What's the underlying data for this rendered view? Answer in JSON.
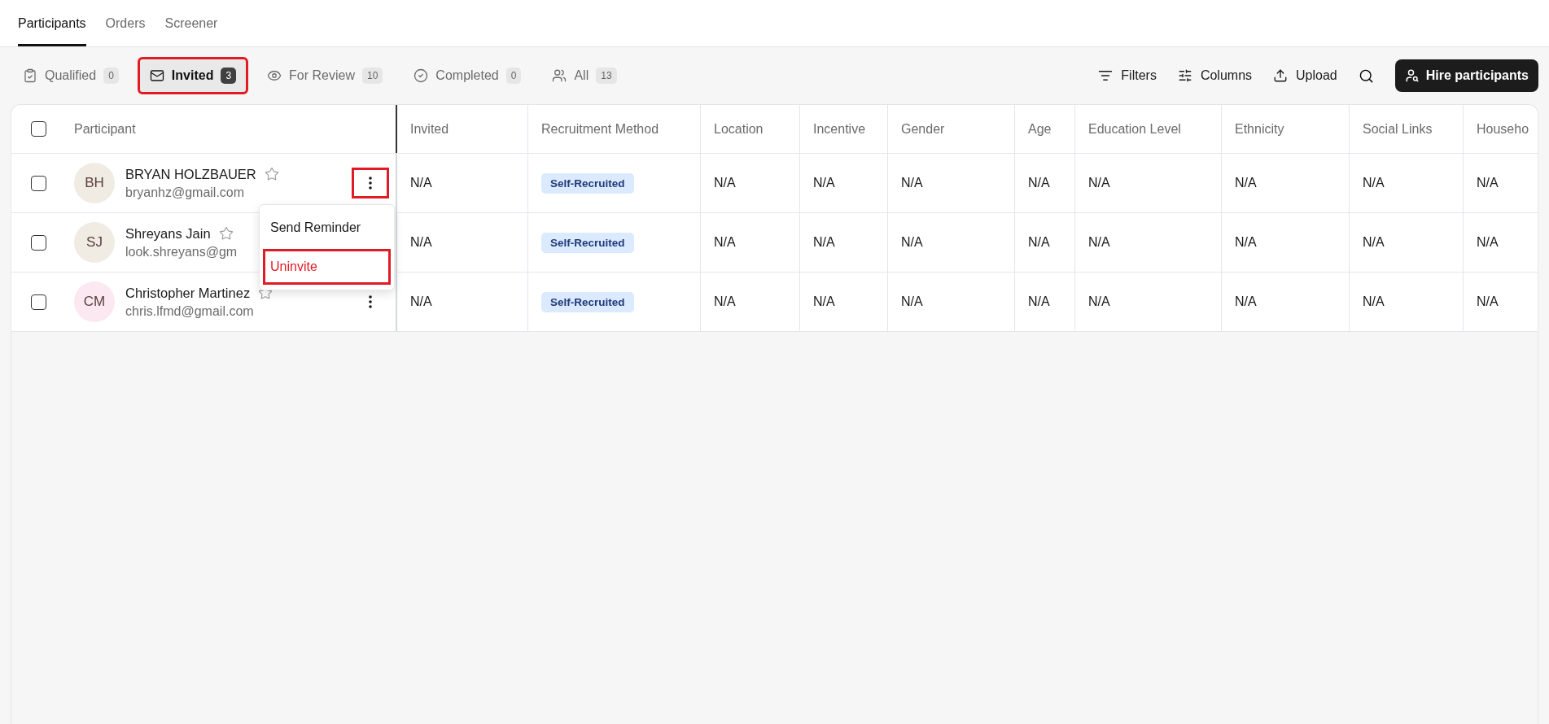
{
  "nav_tabs": [
    {
      "label": "Participants",
      "selected": true
    },
    {
      "label": "Orders",
      "selected": false
    },
    {
      "label": "Screener",
      "selected": false
    }
  ],
  "status_tabs": [
    {
      "label": "Qualified",
      "count": "0",
      "selected": false,
      "highlighted": false
    },
    {
      "label": "Invited",
      "count": "3",
      "selected": true,
      "highlighted": true
    },
    {
      "label": "For Review",
      "count": "10",
      "selected": false,
      "highlighted": false
    },
    {
      "label": "Completed",
      "count": "0",
      "selected": false,
      "highlighted": false
    },
    {
      "label": "All",
      "count": "13",
      "selected": false,
      "highlighted": false
    }
  ],
  "toolbar": {
    "actions": [
      "Filters",
      "Columns",
      "Upload"
    ],
    "primary_button": "Hire participants"
  },
  "table": {
    "all_checked": false,
    "participant_column": "Participant",
    "columns": [
      "Invited",
      "Recruitment Method",
      "Location",
      "Incentive",
      "Gender",
      "Age",
      "Education Level",
      "Ethnicity",
      "Social Links",
      "Househo"
    ],
    "rows": [
      {
        "checked": false,
        "initials": "BH",
        "color": "#f0ebe3",
        "name": "BRYAN HOLZBAUER",
        "email": "bryanhz@gmail.com",
        "starred": false,
        "menu_highlighted": true,
        "menu": [
          {
            "label": "Send Reminder",
            "kind": "normal",
            "highlighted": false
          },
          {
            "label": "Uninvite",
            "kind": "danger",
            "highlighted": true
          }
        ],
        "cells": [
          {
            "kind": "text",
            "value": "N/A"
          },
          {
            "kind": "tag",
            "value": "Self-Recruited"
          },
          {
            "kind": "text",
            "value": "N/A"
          },
          {
            "kind": "text",
            "value": "N/A"
          },
          {
            "kind": "text",
            "value": "N/A"
          },
          {
            "kind": "text",
            "value": "N/A"
          },
          {
            "kind": "text",
            "value": "N/A"
          },
          {
            "kind": "text",
            "value": "N/A"
          },
          {
            "kind": "text",
            "value": "N/A"
          },
          {
            "kind": "text",
            "value": "N/A"
          }
        ]
      },
      {
        "checked": false,
        "initials": "SJ",
        "color": "#f0ebe3",
        "name": "Shreyans Jain",
        "email": "look.shreyans@gm",
        "starred": false,
        "cells": [
          {
            "kind": "text",
            "value": "N/A"
          },
          {
            "kind": "tag",
            "value": "Self-Recruited"
          },
          {
            "kind": "text",
            "value": "N/A"
          },
          {
            "kind": "text",
            "value": "N/A"
          },
          {
            "kind": "text",
            "value": "N/A"
          },
          {
            "kind": "text",
            "value": "N/A"
          },
          {
            "kind": "text",
            "value": "N/A"
          },
          {
            "kind": "text",
            "value": "N/A"
          },
          {
            "kind": "text",
            "value": "N/A"
          },
          {
            "kind": "text",
            "value": "N/A"
          }
        ]
      },
      {
        "checked": false,
        "initials": "CM",
        "color": "#fbe8f0",
        "name": "Christopher Martinez",
        "email": "chris.lfmd@gmail.com",
        "starred": false,
        "menu_highlighted": false,
        "cells": [
          {
            "kind": "text",
            "value": "N/A"
          },
          {
            "kind": "tag",
            "value": "Self-Recruited"
          },
          {
            "kind": "text",
            "value": "N/A"
          },
          {
            "kind": "text",
            "value": "N/A"
          },
          {
            "kind": "text",
            "value": "N/A"
          },
          {
            "kind": "text",
            "value": "N/A"
          },
          {
            "kind": "text",
            "value": "N/A"
          },
          {
            "kind": "text",
            "value": "N/A"
          },
          {
            "kind": "text",
            "value": "N/A"
          },
          {
            "kind": "text",
            "value": "N/A"
          }
        ]
      }
    ]
  }
}
